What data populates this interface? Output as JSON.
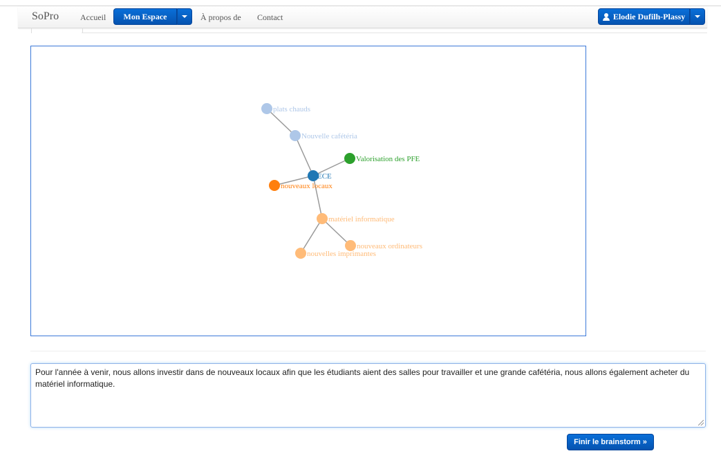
{
  "navbar": {
    "brand": "SoPro",
    "links": [
      {
        "label": "Accueil"
      },
      {
        "label": "À propos de"
      },
      {
        "label": "Contact"
      }
    ],
    "space_button": "Mon Espace",
    "user_button": "Elodie Dufilh-Plassy"
  },
  "mindmap": {
    "nodes": [
      {
        "id": "plats",
        "label": "plats chauds",
        "color": "#aec7e8"
      },
      {
        "id": "cafeteria",
        "label": "Nouvelle cafétéria",
        "color": "#aec7e8"
      },
      {
        "id": "pfe",
        "label": "Valorisation des PFE",
        "color": "#2ca02c"
      },
      {
        "id": "ece",
        "label": "ECE",
        "color": "#1f77b4"
      },
      {
        "id": "locaux",
        "label": "nouveaux locaux",
        "color": "#ff7f0e"
      },
      {
        "id": "materiel",
        "label": "matériel informatique",
        "color": "#ffbb78"
      },
      {
        "id": "ordinateurs",
        "label": "nouveaux ordinateurs",
        "color": "#ffbb78"
      },
      {
        "id": "imprimantes",
        "label": "nouvelles imprimantes",
        "color": "#ffbb78"
      }
    ],
    "links": [
      [
        "plats",
        "cafeteria"
      ],
      [
        "cafeteria",
        "ece"
      ],
      [
        "pfe",
        "ece"
      ],
      [
        "locaux",
        "ece"
      ],
      [
        "ece",
        "materiel"
      ],
      [
        "materiel",
        "ordinateurs"
      ],
      [
        "materiel",
        "imprimantes"
      ]
    ],
    "link_color": "#999999"
  },
  "summary": {
    "text": "Pour l'année à venir, nous allons investir dans de nouveaux locaux afin que les étudiants aient des salles pour travailler et une grande cafétéria, nous allons également acheter du matériel informatique."
  },
  "finish_button": "Finir le brainstorm »"
}
